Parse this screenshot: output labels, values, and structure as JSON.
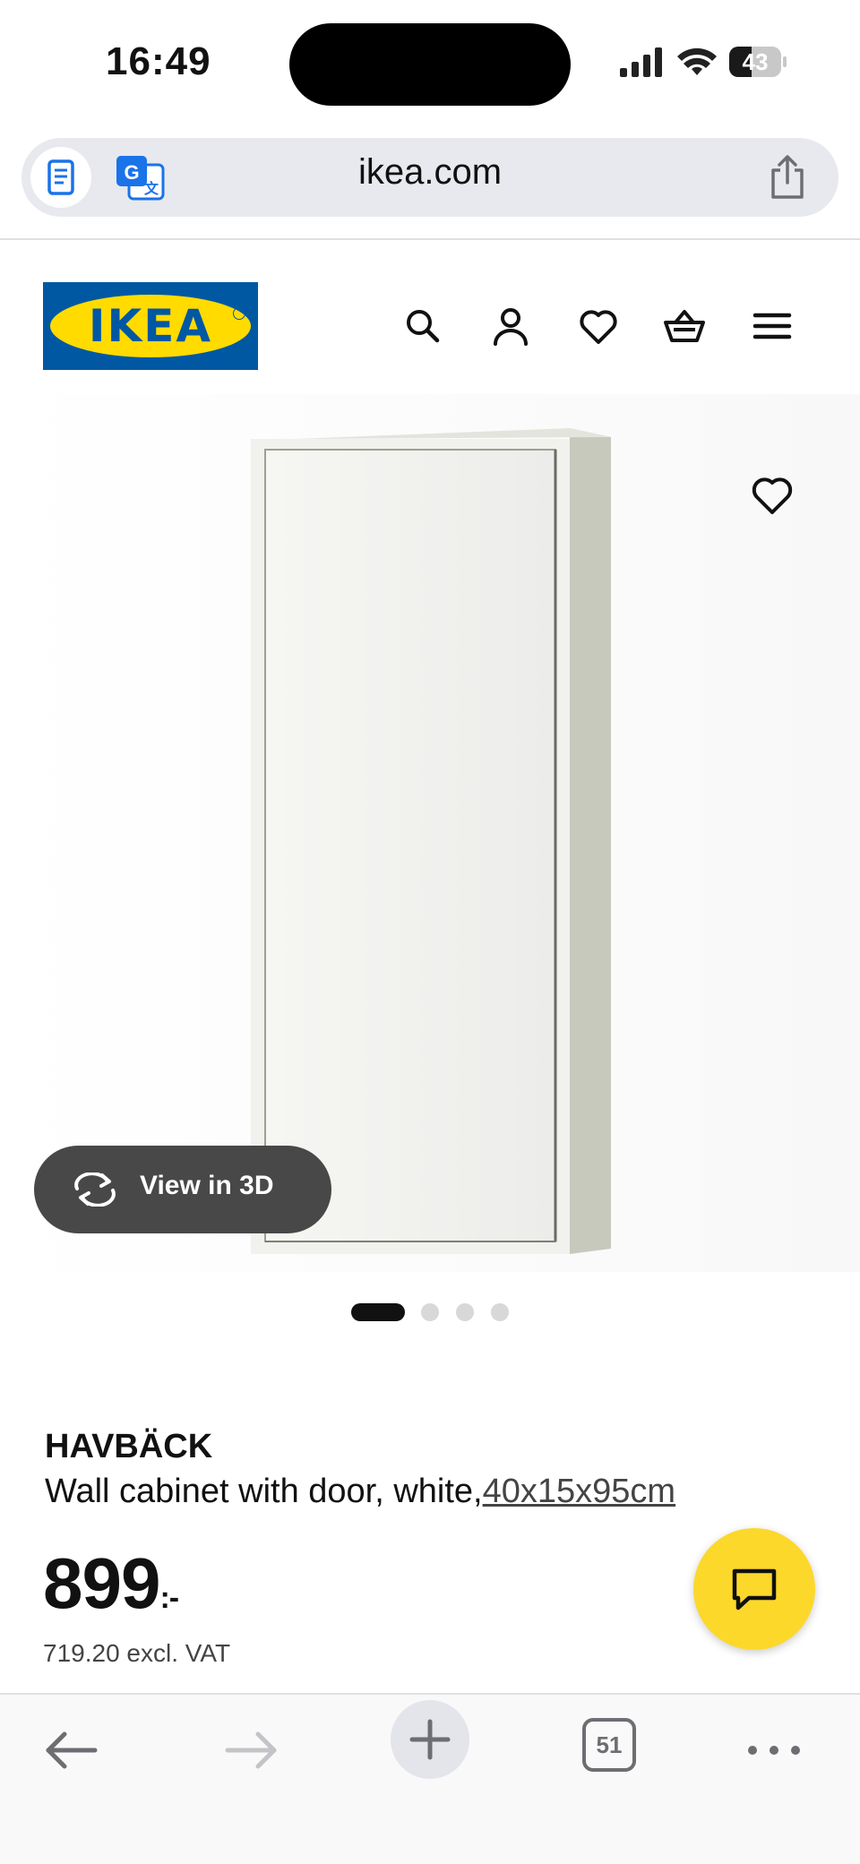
{
  "status_bar": {
    "time": "16:49",
    "battery": "43",
    "battery_level": 0.43
  },
  "browser": {
    "url": "ikea.com",
    "tab_count": "51"
  },
  "header": {
    "logo_text": "IKEA",
    "icons": [
      "search-icon",
      "account-icon",
      "heart-icon",
      "shopping-basket-icon",
      "menu-icon"
    ]
  },
  "gallery": {
    "view_3d_label": "View in 3D",
    "image_count": 4,
    "active_index": 0
  },
  "product": {
    "name": "HAVBÄCK",
    "description": "Wall cabinet with door, white,",
    "dimensions": "40x15x95cm",
    "price": "899",
    "price_suffix": ":-",
    "price_excl_vat": "719.20 excl. VAT"
  },
  "colors": {
    "ikea_blue": "#0058a3",
    "ikea_yellow": "#ffdb00",
    "chat_yellow": "#fcd82b",
    "dark_pill": "#484848"
  }
}
